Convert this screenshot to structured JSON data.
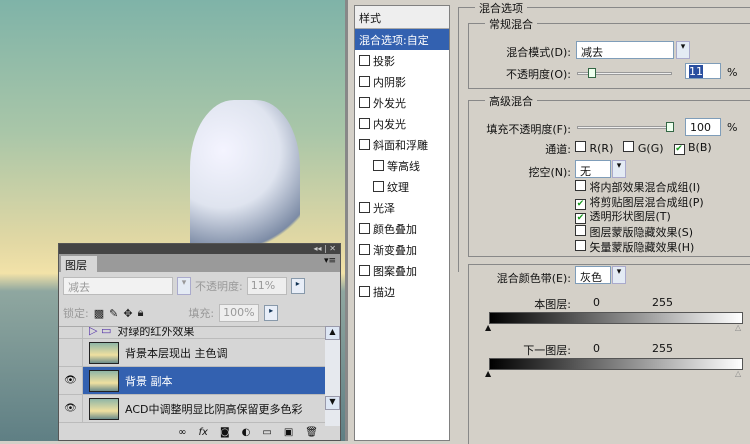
{
  "layers_panel": {
    "tab": "图层",
    "blend_mode": "减去",
    "opacity_label": "不透明度:",
    "opacity": "11%",
    "lock_label": "锁定:",
    "fill_label": "填充:",
    "fill": "100%",
    "layers": [
      {
        "name": "对绿的红外效果",
        "visible": false
      },
      {
        "name": "背景本层现出 主色调",
        "visible": false
      },
      {
        "name": "背景 副本",
        "visible": true,
        "active": true
      },
      {
        "name": "ACD中调整明显比阴高保留更多色彩",
        "visible": true
      }
    ]
  },
  "styles": {
    "header": "样式",
    "items": [
      "混合选项:自定",
      "投影",
      "内阴影",
      "外发光",
      "内发光",
      "斜面和浮雕",
      "等高线",
      "纹理",
      "光泽",
      "颜色叠加",
      "渐变叠加",
      "图案叠加",
      "描边"
    ]
  },
  "blend": {
    "section": "混合选项",
    "general": "常规混合",
    "mode_label": "混合模式(D):",
    "mode": "减去",
    "opacity_label": "不透明度(O):",
    "opacity": "11",
    "pct": "%",
    "advanced": "高级混合",
    "fill_label": "填充不透明度(F):",
    "fill": "100",
    "channels_label": "通道:",
    "channels": [
      {
        "label": "R(R)",
        "checked": false
      },
      {
        "label": "G(G)",
        "checked": false
      },
      {
        "label": "B(B)",
        "checked": true
      }
    ],
    "knockout_label": "挖空(N):",
    "knockout": "无",
    "options": [
      {
        "label": "将内部效果混合成组(I)",
        "checked": false
      },
      {
        "label": "将剪贴图层混合成组(P)",
        "checked": true
      },
      {
        "label": "透明形状图层(T)",
        "checked": true
      },
      {
        "label": "图层蒙版隐藏效果(S)",
        "checked": false
      },
      {
        "label": "矢量蒙版隐藏效果(H)",
        "checked": false
      }
    ],
    "blend_if_label": "混合颜色带(E):",
    "blend_if": "灰色",
    "this_layer": "本图层:",
    "this_min": "0",
    "this_max": "255",
    "underlying": "下一图层:",
    "under_min": "0",
    "under_max": "255"
  },
  "opacity_fraction": 0.11
}
